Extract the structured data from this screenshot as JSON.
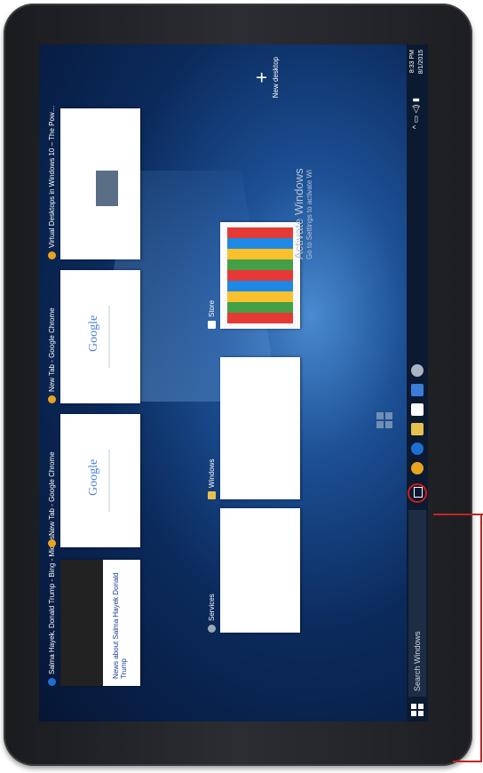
{
  "windows": [
    {
      "caption": "Salma Hayek, Donald Trump - Bing - Micros…",
      "headline": "News about Salma Hayek Donald Trump"
    },
    {
      "caption": "New Tab - Google Chrome",
      "logo": "Google"
    },
    {
      "caption": "New Tab - Google Chrome",
      "logo": "Google"
    },
    {
      "caption": "Virtual Desktops in Windows 10 – The Pow…"
    }
  ],
  "windows_row2": [
    {
      "caption": "Services"
    },
    {
      "caption": "Windows"
    },
    {
      "caption": "Store"
    }
  ],
  "activate": {
    "line1": "Activate Windows",
    "line2": "Go to Settings to activate Wi"
  },
  "new_desktop": {
    "label": "New desktop",
    "plus": "+"
  },
  "taskbar": {
    "search_placeholder": "Search Windows",
    "clock_time": "8:33 PM",
    "clock_date": "8/1/2015"
  },
  "colors": {
    "callout": "#c42424"
  }
}
